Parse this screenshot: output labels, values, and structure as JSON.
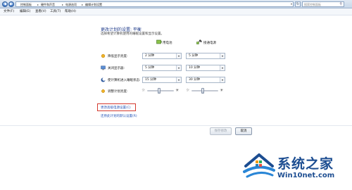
{
  "addressbar": {
    "breadcrumbs": [
      "控制面板",
      "硬件和声音",
      "电源选项",
      "编辑计划设置"
    ],
    "search_placeholder": "搜索控制面板"
  },
  "menu": [
    "文件(F)",
    "编辑(E)",
    "查看(V)",
    "工具(T)",
    "帮助(H)"
  ],
  "page": {
    "heading": "更改计划的设置: 平衡",
    "subheading": "选择希望计算机使用的睡眠设置和显示设置。",
    "columns": {
      "battery": "用电池",
      "plugged": "接通电源"
    },
    "rows": [
      {
        "label": "降低显示亮度:",
        "battery": "2 分钟",
        "plugged": "5 分钟"
      },
      {
        "label": "关闭显示器:",
        "battery": "5 分钟",
        "plugged": "10 分钟"
      },
      {
        "label": "使计算机进入睡眠状态:",
        "battery": "15 分钟",
        "plugged": "30 分钟"
      },
      {
        "label": "调整计划亮度:"
      }
    ],
    "brightness": {
      "battery": 0.45,
      "plugged": 0.4
    },
    "link_advanced": "更改高级电源设置(C)",
    "link_restore": "还原此计划的默认设置(R)"
  },
  "buttons": {
    "save": "保存修改",
    "cancel": "取消"
  },
  "watermark": {
    "title": "系统之家",
    "url": "Win10net.com"
  },
  "colors": {
    "accent_link": "#2454b7",
    "heading": "#1f3b8a",
    "highlight_box": "#d43a2f",
    "watermark": "#1c4d91"
  }
}
